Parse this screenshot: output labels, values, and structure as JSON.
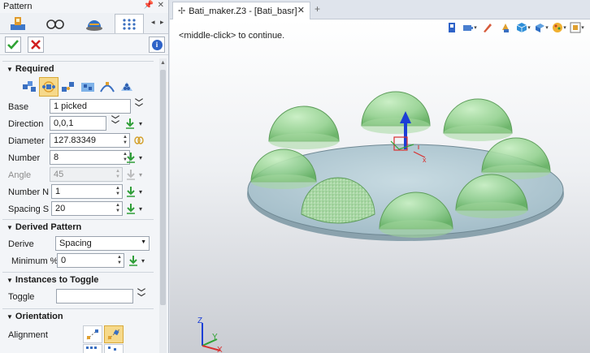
{
  "panel": {
    "title": "Pattern",
    "pin": "📌",
    "close": "✕",
    "nav_left": "◂",
    "nav_right": "▸"
  },
  "sections": {
    "required": "Required",
    "derived": "Derived Pattern",
    "toggle": "Instances to Toggle",
    "orientation": "Orientation"
  },
  "fields": {
    "base": {
      "label": "Base",
      "value": "1 picked"
    },
    "direction": {
      "label": "Direction",
      "value": "0,0,1"
    },
    "diameter": {
      "label": "Diameter",
      "value": "127.83349"
    },
    "number": {
      "label": "Number",
      "value": "8"
    },
    "angle": {
      "label": "Angle",
      "value": "45"
    },
    "number_n": {
      "label": "Number  N",
      "value": "1"
    },
    "spacing_s": {
      "label": "Spacing  S",
      "value": "20"
    },
    "derive": {
      "label": "Derive",
      "value": "Spacing"
    },
    "minimum": {
      "label": "Minimum %",
      "value": "0"
    },
    "toggle": {
      "label": "Toggle",
      "value": ""
    },
    "alignment": {
      "label": "Alignment"
    }
  },
  "document": {
    "tab_title": "Bati_maker.Z3 - [Bati_basr]",
    "new_tab": "+",
    "hint": "<middle-click> to continue."
  },
  "axes": {
    "x": "X",
    "y": "Y",
    "z": "Z"
  },
  "colors": {
    "accent_tab": "#f6d98a",
    "hemisphere": "#8fd08a",
    "disk": "#b7cdd6"
  }
}
